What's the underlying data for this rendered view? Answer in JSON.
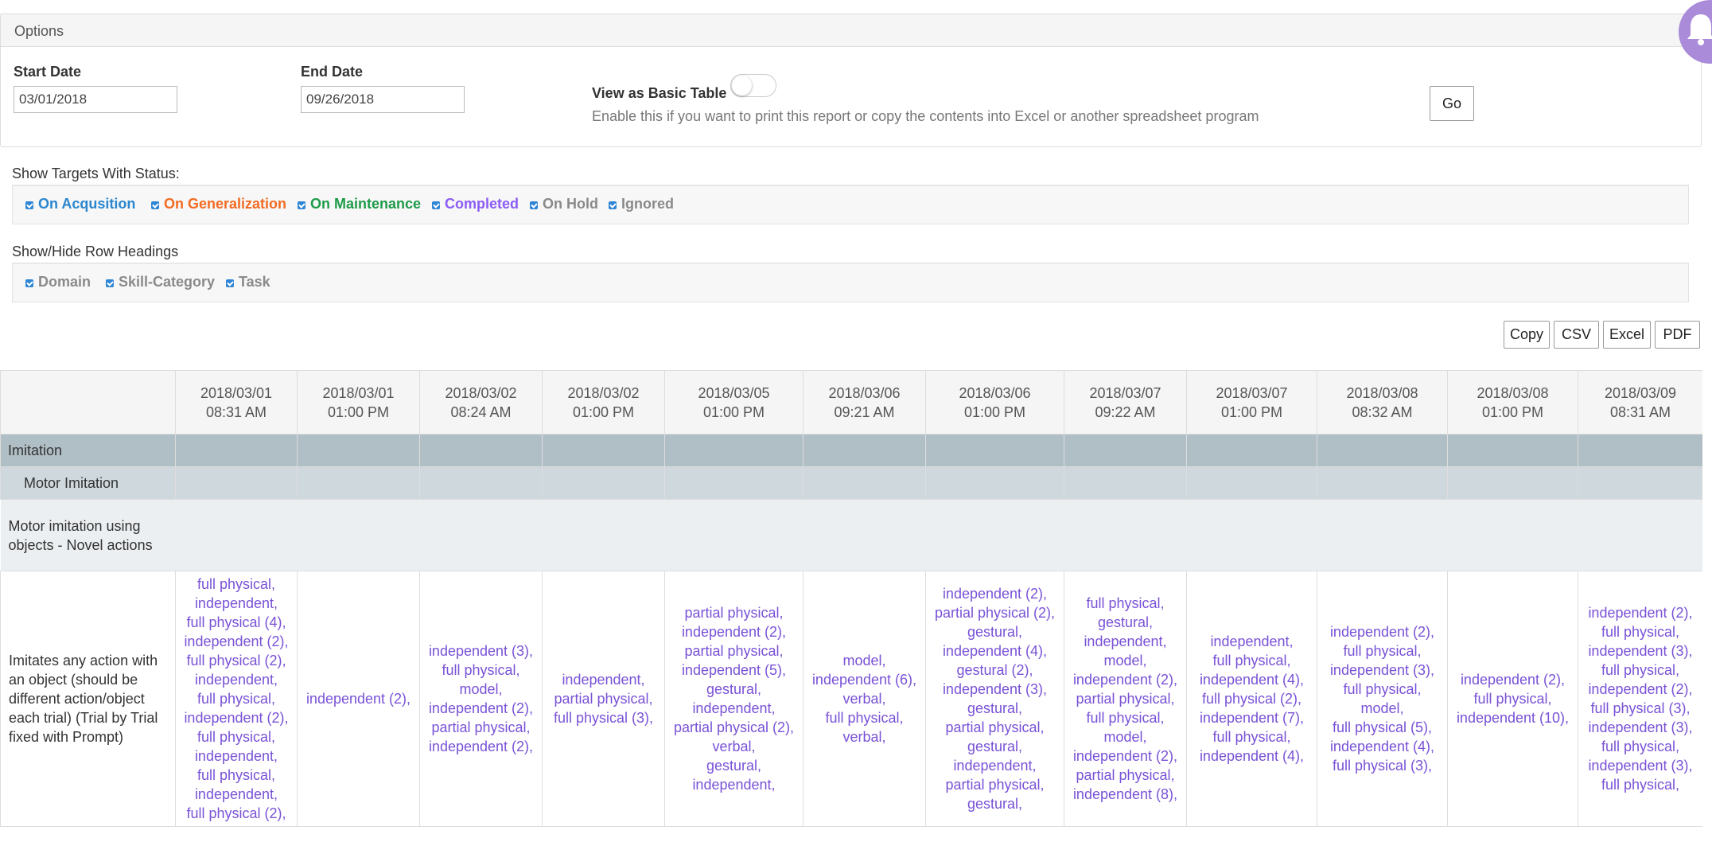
{
  "options": {
    "header": "Options",
    "start_date_label": "Start Date",
    "start_date_value": "03/01/2018",
    "end_date_label": "End Date",
    "end_date_value": "09/26/2018",
    "basic_table_label": "View as Basic Table",
    "basic_table_on": false,
    "basic_table_help": "Enable this if you want to print this report or copy the contents into Excel or another spreadsheet program",
    "go_label": "Go"
  },
  "status_filter": {
    "label": "Show Targets With Status:",
    "items": [
      {
        "label": "On Acqusition",
        "color": "#2a86cf",
        "checked": true
      },
      {
        "label": "On Generalization",
        "color": "#f26b21",
        "checked": true
      },
      {
        "label": "On Maintenance",
        "color": "#1e9b4a",
        "checked": true
      },
      {
        "label": "Completed",
        "color": "#8b5cf6",
        "checked": true
      },
      {
        "label": "On Hold",
        "color": "#8a8a8a",
        "checked": true
      },
      {
        "label": "Ignored",
        "color": "#8a8a8a",
        "checked": true
      }
    ]
  },
  "row_headings": {
    "label": "Show/Hide Row Headings",
    "items": [
      {
        "label": "Domain",
        "color": "#8a8a8a",
        "checked": true
      },
      {
        "label": "Skill-Category",
        "color": "#8a8a8a",
        "checked": true
      },
      {
        "label": "Task",
        "color": "#8a8a8a",
        "checked": true
      }
    ]
  },
  "export_buttons": [
    "Copy",
    "CSV",
    "Excel",
    "PDF"
  ],
  "table": {
    "columns": [
      {
        "date": "2018/03/01",
        "time": "08:31 AM"
      },
      {
        "date": "2018/03/01",
        "time": "01:00 PM"
      },
      {
        "date": "2018/03/02",
        "time": "08:24 AM"
      },
      {
        "date": "2018/03/02",
        "time": "01:00 PM"
      },
      {
        "date": "2018/03/05",
        "time": "01:00 PM"
      },
      {
        "date": "2018/03/06",
        "time": "09:21 AM"
      },
      {
        "date": "2018/03/06",
        "time": "01:00 PM"
      },
      {
        "date": "2018/03/07",
        "time": "09:22 AM"
      },
      {
        "date": "2018/03/07",
        "time": "01:00 PM"
      },
      {
        "date": "2018/03/08",
        "time": "08:32 AM"
      },
      {
        "date": "2018/03/08",
        "time": "01:00 PM"
      },
      {
        "date": "2018/03/09",
        "time": "08:31 AM"
      }
    ],
    "domain": "Imitation",
    "skill_category": "Motor Imitation",
    "task": "Motor imitation using objects - Novel actions",
    "target": "Imitates any action with an object (should be different action/object each trial) (Trial by Trial fixed with Prompt)",
    "cells": [
      [
        "full physical,",
        "independent,",
        "full physical (4),",
        "independent (2),",
        "full physical (2),",
        "independent,",
        "full physical,",
        "independent (2),",
        "full physical,",
        "independent,",
        "full physical,",
        "independent,",
        "full physical (2),"
      ],
      [
        "independent (2),"
      ],
      [
        "independent (3),",
        "full physical,",
        "model,",
        "independent (2),",
        "partial physical,",
        "independent (2),"
      ],
      [
        "independent,",
        "partial physical,",
        "full physical (3),"
      ],
      [
        "partial physical,",
        "independent (2),",
        "partial physical,",
        "independent (5),",
        "gestural,",
        "independent,",
        "partial physical (2),",
        "verbal,",
        "gestural,",
        "independent,"
      ],
      [
        "model,",
        "independent (6),",
        "verbal,",
        "full physical,",
        "verbal,"
      ],
      [
        "independent (2),",
        "partial physical (2),",
        "gestural,",
        "independent (4),",
        "gestural (2),",
        "independent (3),",
        "gestural,",
        "partial physical,",
        "gestural,",
        "independent,",
        "partial physical,",
        "gestural,"
      ],
      [
        "full physical,",
        "gestural,",
        "independent,",
        "model,",
        "independent (2),",
        "partial physical,",
        "full physical,",
        "model,",
        "independent (2),",
        "partial physical,",
        "independent (8),"
      ],
      [
        "independent,",
        "full physical,",
        "independent (4),",
        "full physical (2),",
        "independent (7),",
        "full physical,",
        "independent (4),"
      ],
      [
        "independent (2),",
        "full physical,",
        "independent (3),",
        "full physical,",
        "model,",
        "full physical (5),",
        "independent (4),",
        "full physical (3),"
      ],
      [
        "independent (2),",
        "full physical,",
        "independent (10),"
      ],
      [
        "independent (2),",
        "full physical,",
        "independent (3),",
        "full physical,",
        "independent (2),",
        "full physical (3),",
        "independent (3),",
        "full physical,",
        "independent (3),",
        "full physical,"
      ]
    ]
  }
}
